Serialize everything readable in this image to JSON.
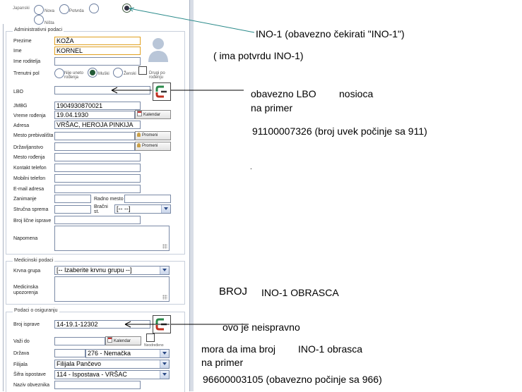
{
  "top": {
    "label": "Japanski",
    "options": [
      {
        "label": "Nova",
        "selected": false
      },
      {
        "label": "Potvrda",
        "selected": false
      },
      {
        "label": "",
        "selected": false
      },
      {
        "label": "",
        "selected": true
      },
      {
        "label": "Ništa",
        "selected": false
      }
    ]
  },
  "admin": {
    "legend": "Administrativni podaci",
    "prezime_label": "Prezime",
    "prezime_value": "KOŽA",
    "ime_label": "Ime",
    "ime_value": "KORNEL",
    "roditelj_label": "Ime roditelja",
    "roditelj_value": "",
    "pol_label": "Trenutni pol",
    "pol_options": [
      {
        "label": "Nije uneto rođenja",
        "selected": false
      },
      {
        "label": "Muški",
        "selected": true
      },
      {
        "label": "Ženski",
        "selected": false
      },
      {
        "label": "Drugi po rođenju",
        "selected": false
      }
    ],
    "lbo_label": "LBO",
    "lbo_value": "",
    "jmbg_label": "JMBG",
    "jmbg_value": "1904930870021",
    "vreme_label": "Vreme rođenja",
    "vreme_value": "19.04.1930",
    "kalendar_label": "Kalendar",
    "adresa_label": "Adresa",
    "adresa_value": "VRŠAC, HEROJA PINKIJA",
    "prebivaliste_label": "Mesto prebivališta",
    "prebivaliste_value": "",
    "promeni_label": "Promeni",
    "drzavljanstvo_label": "Državljanstvo",
    "drzavljanstvo_value": "",
    "mesto_rodjenja_label": "Mesto rođenja",
    "kontakt_label": "Kontakt telefon",
    "mobilni_label": "Mobilni telefon",
    "email_label": "E-mail adresa",
    "zanimanje_label": "Zanimanje",
    "radno_label": "Radno mesto",
    "strucna_label": "Stručna sprema",
    "bracni_label": "Bračni st.",
    "bracni_value": "[-- --]",
    "licna_label": "Broj lične isprave",
    "napomena_label": "Napomena"
  },
  "medical": {
    "legend": "Medicinski podaci",
    "krvna_label": "Krvna grupa",
    "krvna_value": "[-- Izaberite krvnu grupu --]",
    "upozorenja_label": "Medicinska upozorenja"
  },
  "insurance": {
    "legend": "Podaci o osiguranju",
    "broj_label": "Broj isprave",
    "broj_value": "14-19.1-12302",
    "vazi_label": "Važi do",
    "vazi_value": "",
    "kalendar_label": "Kalendar",
    "neodredjeno_label": "Neodređeno",
    "drzava_label": "Država",
    "drzava_value": "276 - Nemačka",
    "filijala_label": "Filijala",
    "filijala_value": "Filijala Pančevo",
    "ispostava_label": "Šifra ispostave",
    "ispostava_value": "114 - Ispostava - VRŠAC",
    "obveznik_label": "Naziv obveznika"
  },
  "annotations": {
    "ino1": "INO-1 (obavezno čekirati \"INO-1\")",
    "ino1_sub": "( ima potvrdu INO-1)",
    "lbo_line1a": "obavezno LBO",
    "lbo_line1b": "nosioca",
    "lbo_line2": "na primer",
    "lbo_example": "91100007326 (broj uvek počinje sa 911)",
    "dot": ".",
    "broj_a": "BROJ",
    "broj_b": "INO-1 OBRASCA",
    "neispravno": "ovo je neispravno",
    "mora_a": "mora da ima broj",
    "mora_b": "INO-1 obrasca",
    "primer2": "na primer",
    "example2": "96600003105 (obavezno počinje sa 966)"
  },
  "colors": {
    "ino_arrow": "#2a8a8a",
    "input_border": "#7a8aa6",
    "highlight_border": "#e0a020"
  }
}
